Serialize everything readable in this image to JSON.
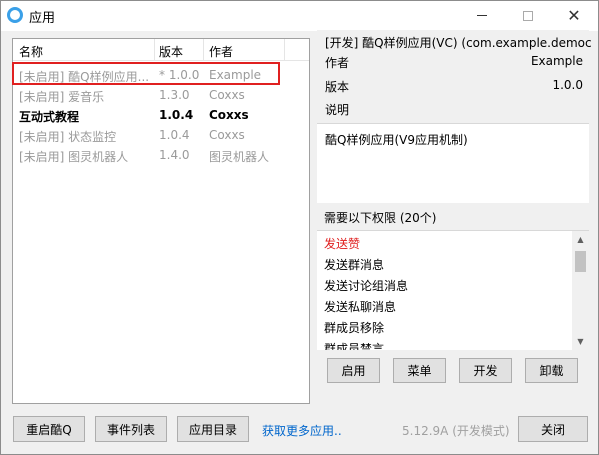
{
  "window": {
    "title": "应用"
  },
  "list": {
    "headers": [
      "名称",
      "版本",
      "作者"
    ],
    "rows": [
      {
        "name": "[未启用] 酷Q样例应用...",
        "version": "* 1.0.0",
        "author": "Example",
        "state": "disabled"
      },
      {
        "name": "[未启用] 爱音乐",
        "version": "1.3.0",
        "author": "Coxxs",
        "state": "disabled"
      },
      {
        "name": "互动式教程",
        "version": "1.0.4",
        "author": "Coxxs",
        "state": "enabled"
      },
      {
        "name": "[未启用] 状态监控",
        "version": "1.0.4",
        "author": "Coxxs",
        "state": "disabled"
      },
      {
        "name": "[未启用] 图灵机器人",
        "version": "1.4.0",
        "author": "图灵机器人",
        "state": "disabled"
      }
    ]
  },
  "detail": {
    "title": "[开发] 酷Q样例应用(VC) (com.example.democ)",
    "author_label": "作者",
    "author_value": "Example",
    "version_label": "版本",
    "version_value": "1.0.0",
    "desc_label": "说明",
    "description": "酷Q样例应用(V9应用机制)"
  },
  "permissions": {
    "title": "需要以下权限 (20个)",
    "items": [
      "发送赞",
      "发送群消息",
      "发送讨论组消息",
      "发送私聊消息",
      "群成员移除",
      "群成员禁言"
    ]
  },
  "actions": {
    "enable": "启用",
    "menu": "菜单",
    "dev": "开发",
    "uninstall": "卸载"
  },
  "bottom": {
    "restart": "重启酷Q",
    "events": "事件列表",
    "app_dir": "应用目录",
    "more_link": "获取更多应用..",
    "version": "5.12.9A (开发模式)",
    "close": "关闭"
  },
  "colors": {
    "accent_red": "#e02020",
    "link_blue": "#0066cc",
    "disabled_gray": "#9a9a9a"
  }
}
